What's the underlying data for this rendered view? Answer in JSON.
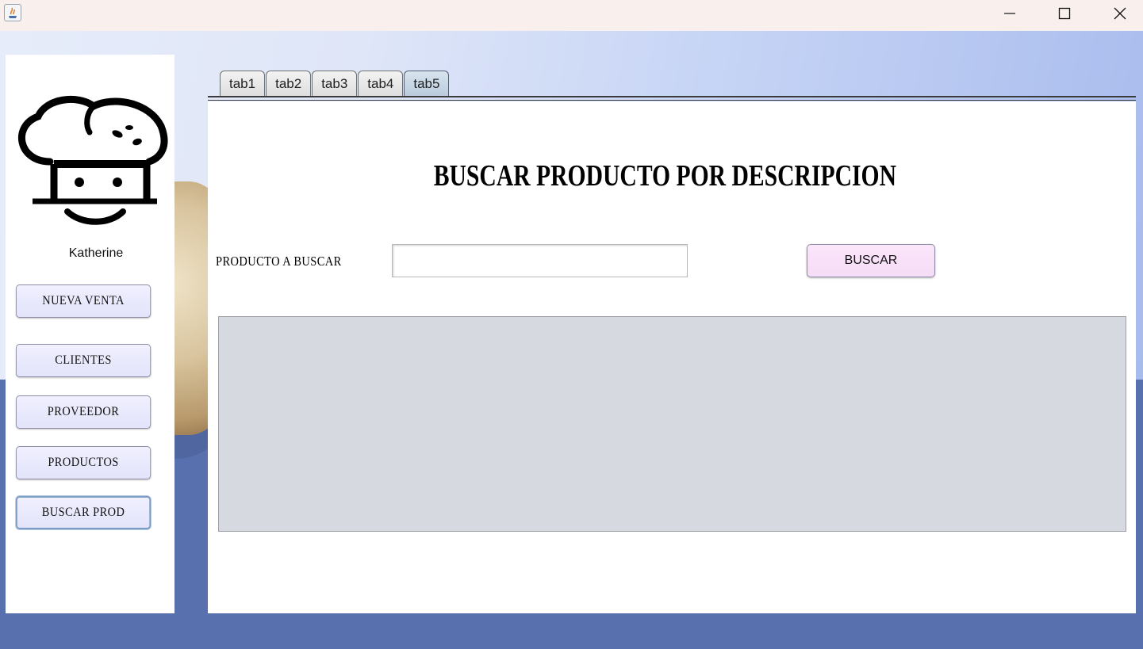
{
  "window": {
    "app_icon": "java-icon",
    "controls": {
      "minimize": "minimize-icon",
      "maximize": "maximize-icon",
      "close": "close-icon"
    }
  },
  "sidebar": {
    "logo_icon": "chef-hat-icon",
    "user_name": "Katherine",
    "buttons": [
      {
        "label": "NUEVA VENTA"
      },
      {
        "label": "CLIENTES"
      },
      {
        "label": "PROVEEDOR"
      },
      {
        "label": "PRODUCTOS"
      },
      {
        "label": "BUSCAR PROD"
      }
    ]
  },
  "tabs": {
    "items": [
      {
        "label": "tab1"
      },
      {
        "label": "tab2"
      },
      {
        "label": "tab3"
      },
      {
        "label": "tab4"
      },
      {
        "label": "tab5"
      }
    ],
    "selected": "tab5"
  },
  "main": {
    "title": "BUSCAR PRODUCTO POR DESCRIPCION",
    "search_label": "PRODUCTO A BUSCAR",
    "search_value": "",
    "search_button": "BUSCAR"
  },
  "colors": {
    "sidebar_button": "#e6e6fa",
    "search_button": "#f8e0f8",
    "results_area": "#d6d9e0",
    "selected_tab": "#c3d3e3"
  }
}
